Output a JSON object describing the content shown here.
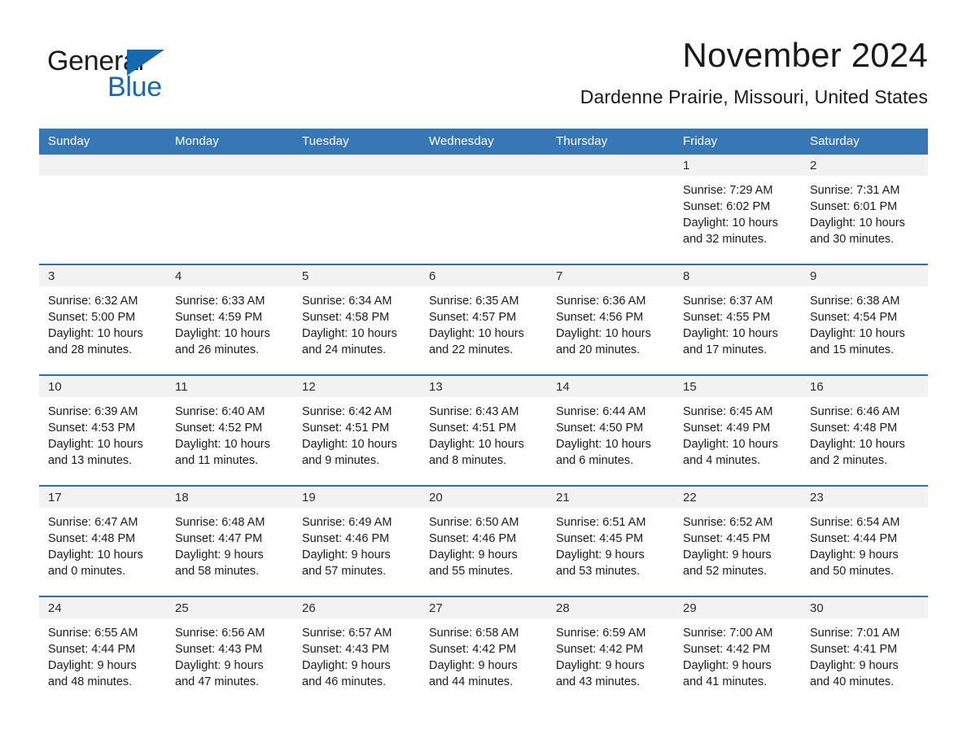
{
  "brand": {
    "name_part1": "General",
    "name_part2": "Blue",
    "accent_color": "#1569b0"
  },
  "header": {
    "month_title": "November 2024",
    "location": "Dardenne Prairie, Missouri, United States"
  },
  "calendar": {
    "header_bg": "#3877b5",
    "row_border_color": "#2f6fae",
    "daynum_bg": "#f2f2f2",
    "weekday_headers": [
      "Sunday",
      "Monday",
      "Tuesday",
      "Wednesday",
      "Thursday",
      "Friday",
      "Saturday"
    ],
    "weeks": [
      [
        {
          "day": "",
          "lines": []
        },
        {
          "day": "",
          "lines": []
        },
        {
          "day": "",
          "lines": []
        },
        {
          "day": "",
          "lines": []
        },
        {
          "day": "",
          "lines": []
        },
        {
          "day": "1",
          "lines": [
            "Sunrise: 7:29 AM",
            "Sunset: 6:02 PM",
            "Daylight: 10 hours",
            "and 32 minutes."
          ]
        },
        {
          "day": "2",
          "lines": [
            "Sunrise: 7:31 AM",
            "Sunset: 6:01 PM",
            "Daylight: 10 hours",
            "and 30 minutes."
          ]
        }
      ],
      [
        {
          "day": "3",
          "lines": [
            "Sunrise: 6:32 AM",
            "Sunset: 5:00 PM",
            "Daylight: 10 hours",
            "and 28 minutes."
          ]
        },
        {
          "day": "4",
          "lines": [
            "Sunrise: 6:33 AM",
            "Sunset: 4:59 PM",
            "Daylight: 10 hours",
            "and 26 minutes."
          ]
        },
        {
          "day": "5",
          "lines": [
            "Sunrise: 6:34 AM",
            "Sunset: 4:58 PM",
            "Daylight: 10 hours",
            "and 24 minutes."
          ]
        },
        {
          "day": "6",
          "lines": [
            "Sunrise: 6:35 AM",
            "Sunset: 4:57 PM",
            "Daylight: 10 hours",
            "and 22 minutes."
          ]
        },
        {
          "day": "7",
          "lines": [
            "Sunrise: 6:36 AM",
            "Sunset: 4:56 PM",
            "Daylight: 10 hours",
            "and 20 minutes."
          ]
        },
        {
          "day": "8",
          "lines": [
            "Sunrise: 6:37 AM",
            "Sunset: 4:55 PM",
            "Daylight: 10 hours",
            "and 17 minutes."
          ]
        },
        {
          "day": "9",
          "lines": [
            "Sunrise: 6:38 AM",
            "Sunset: 4:54 PM",
            "Daylight: 10 hours",
            "and 15 minutes."
          ]
        }
      ],
      [
        {
          "day": "10",
          "lines": [
            "Sunrise: 6:39 AM",
            "Sunset: 4:53 PM",
            "Daylight: 10 hours",
            "and 13 minutes."
          ]
        },
        {
          "day": "11",
          "lines": [
            "Sunrise: 6:40 AM",
            "Sunset: 4:52 PM",
            "Daylight: 10 hours",
            "and 11 minutes."
          ]
        },
        {
          "day": "12",
          "lines": [
            "Sunrise: 6:42 AM",
            "Sunset: 4:51 PM",
            "Daylight: 10 hours",
            "and 9 minutes."
          ]
        },
        {
          "day": "13",
          "lines": [
            "Sunrise: 6:43 AM",
            "Sunset: 4:51 PM",
            "Daylight: 10 hours",
            "and 8 minutes."
          ]
        },
        {
          "day": "14",
          "lines": [
            "Sunrise: 6:44 AM",
            "Sunset: 4:50 PM",
            "Daylight: 10 hours",
            "and 6 minutes."
          ]
        },
        {
          "day": "15",
          "lines": [
            "Sunrise: 6:45 AM",
            "Sunset: 4:49 PM",
            "Daylight: 10 hours",
            "and 4 minutes."
          ]
        },
        {
          "day": "16",
          "lines": [
            "Sunrise: 6:46 AM",
            "Sunset: 4:48 PM",
            "Daylight: 10 hours",
            "and 2 minutes."
          ]
        }
      ],
      [
        {
          "day": "17",
          "lines": [
            "Sunrise: 6:47 AM",
            "Sunset: 4:48 PM",
            "Daylight: 10 hours",
            "and 0 minutes."
          ]
        },
        {
          "day": "18",
          "lines": [
            "Sunrise: 6:48 AM",
            "Sunset: 4:47 PM",
            "Daylight: 9 hours",
            "and 58 minutes."
          ]
        },
        {
          "day": "19",
          "lines": [
            "Sunrise: 6:49 AM",
            "Sunset: 4:46 PM",
            "Daylight: 9 hours",
            "and 57 minutes."
          ]
        },
        {
          "day": "20",
          "lines": [
            "Sunrise: 6:50 AM",
            "Sunset: 4:46 PM",
            "Daylight: 9 hours",
            "and 55 minutes."
          ]
        },
        {
          "day": "21",
          "lines": [
            "Sunrise: 6:51 AM",
            "Sunset: 4:45 PM",
            "Daylight: 9 hours",
            "and 53 minutes."
          ]
        },
        {
          "day": "22",
          "lines": [
            "Sunrise: 6:52 AM",
            "Sunset: 4:45 PM",
            "Daylight: 9 hours",
            "and 52 minutes."
          ]
        },
        {
          "day": "23",
          "lines": [
            "Sunrise: 6:54 AM",
            "Sunset: 4:44 PM",
            "Daylight: 9 hours",
            "and 50 minutes."
          ]
        }
      ],
      [
        {
          "day": "24",
          "lines": [
            "Sunrise: 6:55 AM",
            "Sunset: 4:44 PM",
            "Daylight: 9 hours",
            "and 48 minutes."
          ]
        },
        {
          "day": "25",
          "lines": [
            "Sunrise: 6:56 AM",
            "Sunset: 4:43 PM",
            "Daylight: 9 hours",
            "and 47 minutes."
          ]
        },
        {
          "day": "26",
          "lines": [
            "Sunrise: 6:57 AM",
            "Sunset: 4:43 PM",
            "Daylight: 9 hours",
            "and 46 minutes."
          ]
        },
        {
          "day": "27",
          "lines": [
            "Sunrise: 6:58 AM",
            "Sunset: 4:42 PM",
            "Daylight: 9 hours",
            "and 44 minutes."
          ]
        },
        {
          "day": "28",
          "lines": [
            "Sunrise: 6:59 AM",
            "Sunset: 4:42 PM",
            "Daylight: 9 hours",
            "and 43 minutes."
          ]
        },
        {
          "day": "29",
          "lines": [
            "Sunrise: 7:00 AM",
            "Sunset: 4:42 PM",
            "Daylight: 9 hours",
            "and 41 minutes."
          ]
        },
        {
          "day": "30",
          "lines": [
            "Sunrise: 7:01 AM",
            "Sunset: 4:41 PM",
            "Daylight: 9 hours",
            "and 40 minutes."
          ]
        }
      ]
    ]
  }
}
